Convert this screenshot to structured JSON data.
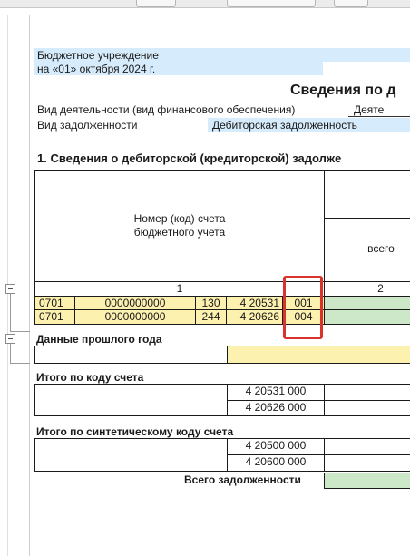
{
  "header": {
    "org_label": "Бюджетное учреждение",
    "date_label": "на «01» октября 2024 г.",
    "report_title": "Сведения по д",
    "activity_label": "Вид деятельности (вид финансового обеспечения)",
    "activity_value": "Деяте",
    "debt_type_label": "Вид задолженности",
    "debt_type_value": "Дебиторская задолженность"
  },
  "section1": {
    "title": "1. Сведения о дебиторской (кредиторской) задолже"
  },
  "table": {
    "col1_header": "Номер (код) счета бюджетного учета",
    "col1_header_line1": "Номер (код) счета",
    "col1_header_line2": "бюджетного учета",
    "col2_header": "всего",
    "col_numbers": [
      "1",
      "2"
    ],
    "rows": [
      {
        "c1": "0701",
        "c2": "0000000000",
        "c3": "130",
        "c4": "4 20531",
        "c5": "001"
      },
      {
        "c1": "0701",
        "c2": "0000000000",
        "c3": "244",
        "c4": "4 20626",
        "c5": "004"
      }
    ],
    "prev_year_label": "Данные прошлого года",
    "total_by_account_label": "Итого по коду счета",
    "total_by_account_codes": [
      "4 20531 000",
      "4 20626 000"
    ],
    "total_synthetic_label": "Итого по синтетическому коду счета",
    "total_synthetic_codes": [
      "4 20500 000",
      "4 20600 000"
    ],
    "grand_total_label": "Всего задолженности"
  },
  "colors": {
    "header_bg": "#d6ebfb",
    "row_yellow": "#fdf1b0",
    "row_green": "#cde8c8",
    "highlight": "#d9342b"
  }
}
